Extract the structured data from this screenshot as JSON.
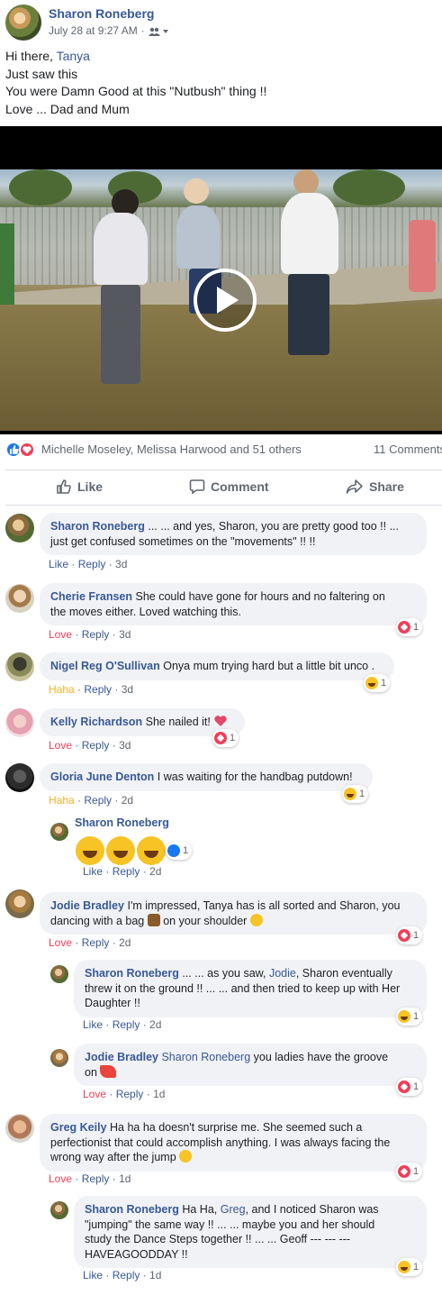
{
  "post": {
    "author": "Sharon Roneberg",
    "timestamp": "July 28 at 9:27 AM",
    "audience_separator": "·",
    "lines": {
      "greeting_prefix": "Hi there,",
      "greeting_tag": "Tanya",
      "line2": "Just saw this",
      "line3": "You were Damn Good at this \"Nutbush\" thing !!",
      "line4": "Love ... Dad and Mum"
    }
  },
  "video": {
    "state": "paused"
  },
  "reactions": {
    "names": "Michelle Moseley, Melissa Harwood and 51 others",
    "comment_count": "11 Comments"
  },
  "actions": {
    "like": "Like",
    "comment": "Comment",
    "share": "Share"
  },
  "icons": {
    "audience": "friends-icon",
    "like": "thumbs-up-icon",
    "comment": "speech-bubble-icon",
    "share": "share-arrow-icon",
    "play": "play-icon"
  },
  "colors": {
    "link": "#385898",
    "love": "#f33e58",
    "haha": "#f7b125",
    "like": "#1877f2",
    "bubble": "#f0f2f5"
  },
  "comments": [
    {
      "name": "Sharon Roneberg",
      "text1": "... ... and yes, Sharon, you are pretty good too !! ...",
      "text2": "just get confused sometimes on the \"movements\" !! !!",
      "reaction": "Like",
      "reply": "Reply",
      "age": "3d"
    },
    {
      "name": "Cherie Fransen",
      "text1": "She could have gone for hours and no faltering on",
      "text2": "the moves either. Loved watching this.",
      "reaction": "Love",
      "reply": "Reply",
      "age": "3d",
      "badge_count": "1"
    },
    {
      "name": "Nigel Reg O'Sullivan",
      "text1": "Onya mum trying hard but a little bit unco .",
      "reaction": "Haha",
      "reply": "Reply",
      "age": "3d",
      "badge_count": "1"
    },
    {
      "name": "Kelly Richardson",
      "text1": "She nailed it!",
      "reaction": "Love",
      "reply": "Reply",
      "age": "3d",
      "badge_count": "1"
    },
    {
      "name": "Gloria June Denton",
      "text1": "I was waiting for the handbag putdown!",
      "reaction": "Haha",
      "reply": "Reply",
      "age": "2d",
      "badge_count": "1",
      "reply_item": {
        "name": "Sharon Roneberg",
        "reaction": "Like",
        "reply": "Reply",
        "age": "2d",
        "badge_count": "1"
      }
    },
    {
      "name": "Jodie Bradley",
      "text1": "I'm impressed, Tanya has is all sorted and Sharon, you",
      "text2_a": "dancing with a bag",
      "text2_b": "on your shoulder",
      "reaction": "Love",
      "reply": "Reply",
      "age": "2d",
      "badge_count": "1",
      "replies": [
        {
          "name": "Sharon Roneberg",
          "text1_a": "... ... as you saw,",
          "text1_tag": "Jodie",
          "text1_b": ", Sharon eventually",
          "text2": "threw it on the ground !! ... ... and then tried to keep up with Her",
          "text3": "Daughter !!",
          "reaction": "Like",
          "reply": "Reply",
          "age": "2d",
          "badge_count": "1"
        },
        {
          "name": "Jodie Bradley",
          "tag": "Sharon Roneberg",
          "text1": "you ladies have the groove",
          "text2": "on",
          "reaction": "Love",
          "reply": "Reply",
          "age": "1d",
          "badge_count": "1"
        }
      ]
    },
    {
      "name": "Greg Keily",
      "text1": "Ha ha ha doesn't surprise me. She seemed such a",
      "text2": "perfectionist that could accomplish anything. I was always facing the",
      "text3": "wrong way after the jump",
      "reaction": "Love",
      "reply": "Reply",
      "age": "1d",
      "badge_count": "1",
      "reply_item": {
        "name": "Sharon Roneberg",
        "text1_a": "Ha Ha,",
        "text1_tag": "Greg",
        "text1_b": ", and I noticed Sharon was",
        "text2": "\"jumping\" the same way !! ... ... maybe you and her should",
        "text3": "study the Dance Steps together !! ... ... Geoff --- --- ---",
        "text4": "HAVEAGOODDAY !!",
        "reaction": "Like",
        "reply": "Reply",
        "age": "1d",
        "badge_count": "1"
      }
    }
  ]
}
